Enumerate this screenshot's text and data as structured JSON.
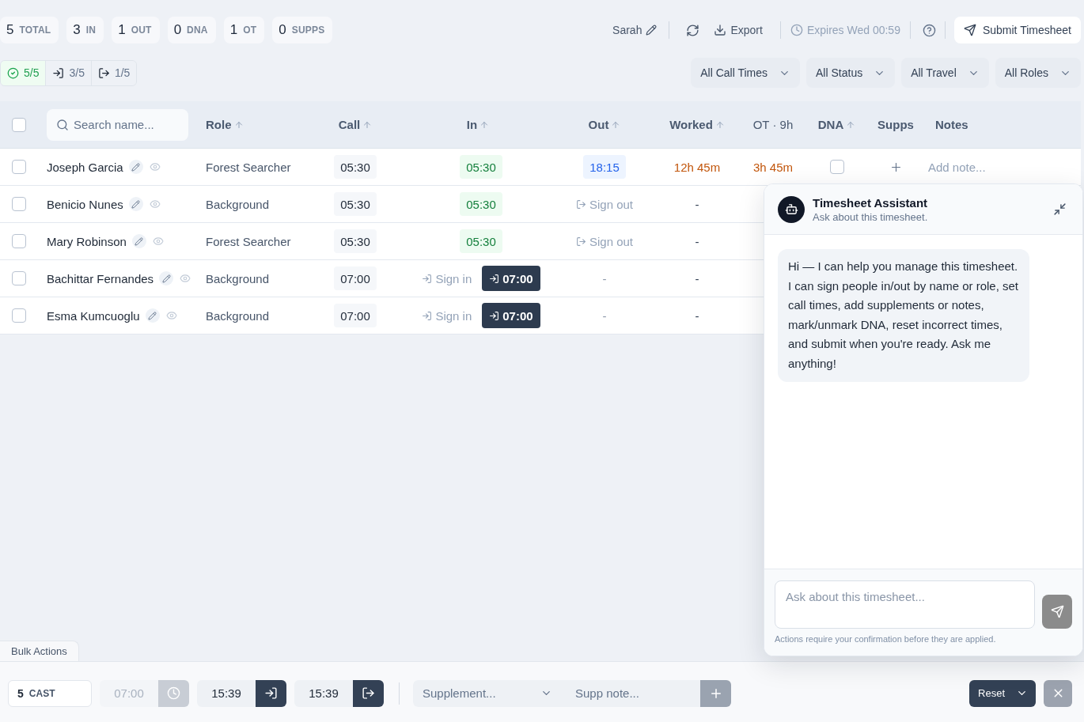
{
  "stats": [
    {
      "value": "5",
      "label": "TOTAL"
    },
    {
      "value": "3",
      "label": "IN"
    },
    {
      "value": "1",
      "label": "OUT"
    },
    {
      "value": "0",
      "label": "DNA"
    },
    {
      "value": "1",
      "label": "OT"
    },
    {
      "value": "0",
      "label": "SUPPS"
    }
  ],
  "progress_filters": [
    {
      "kind": "done",
      "label": "5/5",
      "selected": true
    },
    {
      "kind": "signed_in",
      "label": "3/5",
      "selected": false
    },
    {
      "kind": "signed_out",
      "label": "1/5",
      "selected": false
    }
  ],
  "toolbar": {
    "user": "Sarah",
    "export": "Export",
    "expiry": "Expires Wed 00:59",
    "submit": "Submit Timesheet"
  },
  "filters": [
    "All Call Times",
    "All Status",
    "All Travel",
    "All Roles"
  ],
  "table": {
    "select_all": {
      "checked": false
    },
    "search": {
      "placeholder": "Search name..."
    },
    "columns": [
      {
        "label": "Role",
        "kind": "sort"
      },
      {
        "label": "Call",
        "kind": "sort"
      },
      {
        "label": "In",
        "kind": "sort"
      },
      {
        "label": "Out",
        "kind": "sort"
      },
      {
        "label": "Worked",
        "kind": "sort"
      },
      {
        "label": "OT · 9h",
        "kind": "info"
      },
      {
        "label": "DNA",
        "kind": "sort"
      },
      {
        "label": "Supps",
        "kind": "plain"
      },
      {
        "label": "Notes",
        "kind": "plain"
      }
    ],
    "rows": [
      {
        "name": "Joseph Garcia",
        "checked": false,
        "role": "Forest Searcher",
        "call": "05:30",
        "in": {
          "kind": "time",
          "value": "05:30"
        },
        "out": {
          "kind": "time",
          "value": "18:15"
        },
        "worked": {
          "value": "12h 45m",
          "overtime": true
        },
        "ot": "3h 45m",
        "dna": false,
        "supps": {
          "kind": "add"
        },
        "notes": {
          "placeholder": "Add note..."
        }
      },
      {
        "name": "Benicio Nunes",
        "checked": false,
        "role": "Background",
        "call": "05:30",
        "in": {
          "kind": "time",
          "value": "05:30"
        },
        "out": {
          "kind": "action",
          "action": "Sign out"
        },
        "worked": {
          "value": "-",
          "overtime": false
        }
      },
      {
        "name": "Mary Robinson",
        "checked": false,
        "role": "Forest Searcher",
        "call": "05:30",
        "in": {
          "kind": "time",
          "value": "05:30"
        },
        "out": {
          "kind": "action",
          "action": "Sign out"
        },
        "worked": {
          "value": "-",
          "overtime": false
        }
      },
      {
        "name": "Bachittar Fernandes",
        "checked": false,
        "role": "Background",
        "call": "07:00",
        "in": {
          "kind": "pending",
          "action": "Sign in",
          "time": "07:00"
        },
        "out": {
          "kind": "empty",
          "value": "-"
        },
        "worked": {
          "value": "-",
          "overtime": false
        }
      },
      {
        "name": "Esma Kumcuoglu",
        "checked": false,
        "role": "Background",
        "call": "07:00",
        "in": {
          "kind": "pending",
          "action": "Sign in",
          "time": "07:00"
        },
        "out": {
          "kind": "empty",
          "value": "-"
        },
        "worked": {
          "value": "-",
          "overtime": false
        }
      }
    ]
  },
  "assistant": {
    "title": "Timesheet Assistant",
    "subtitle": "Ask about this timesheet.",
    "messages": [
      "Hi — I can help you manage this timesheet. I can sign people in/out by name or role, set call times, add supplements or notes, mark/unmark DNA, reset incorrect times, and submit when you're ready. Ask me anything!"
    ],
    "input": {
      "placeholder": "Ask about this timesheet..."
    },
    "send_disabled": true,
    "note": "Actions require your confirmation before they are applied."
  },
  "bulk_actions": {
    "tab": "Bulk Actions",
    "cast": {
      "count": "5",
      "label": "CAST"
    },
    "call_time": {
      "placeholder": "07:00",
      "disabled": true
    },
    "sign_in_time": "15:39",
    "sign_out_time": "15:39",
    "supplement": {
      "placeholder": "Supplement..."
    },
    "supp_note": {
      "placeholder": "Supp note..."
    },
    "reset": "Reset"
  }
}
